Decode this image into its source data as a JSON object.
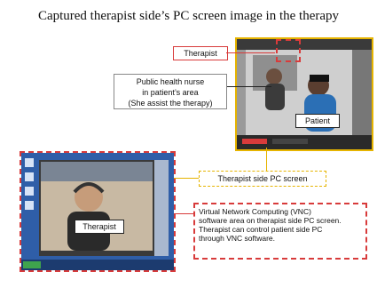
{
  "slide": {
    "title": "Captured therapist side’s PC screen image in the therapy"
  },
  "callouts": {
    "therapist_top": "Therapist",
    "nurse_line1": "Public health nurse",
    "nurse_line2": "in patient’s area",
    "nurse_line3": "(She assist the therapy)",
    "patient": "Patient",
    "therapist_bottom": "Therapist",
    "pc_screen": "Therapist side PC screen",
    "vnc_line1": "Virtual Network Computing (VNC)",
    "vnc_line2": "software area on therapist side PC screen.",
    "vnc_line3": "Therapist can control patient side PC",
    "vnc_line4": "through VNC software."
  },
  "colors": {
    "accent_red": "#d83b3b",
    "accent_yellow": "#e6b400",
    "desktop_blue": "#2f5ea8"
  }
}
